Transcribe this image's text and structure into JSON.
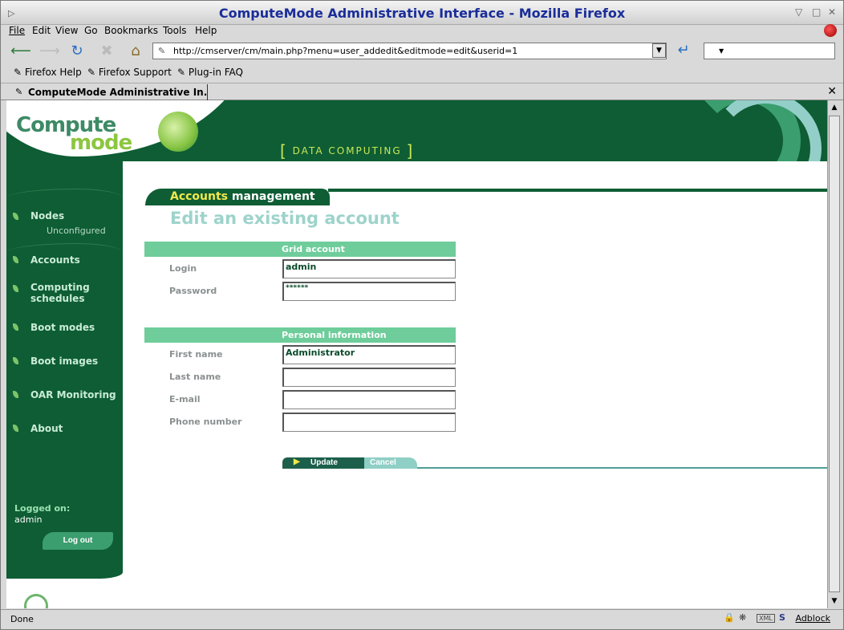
{
  "window": {
    "title": "ComputeMode Administrative Interface - Mozilla Firefox"
  },
  "menu": [
    "File",
    "Edit",
    "View",
    "Go",
    "Bookmarks",
    "Tools",
    "Help"
  ],
  "address": {
    "url": "http://cmserver/cm/main.php?menu=user_addedit&editmode=edit&userid=1"
  },
  "bookmarks": [
    "Firefox Help",
    "Firefox Support",
    "Plug-in FAQ"
  ],
  "tab": {
    "title": "ComputeMode Administrative In..."
  },
  "status": {
    "text": "Done",
    "adblock": "Adblock"
  },
  "brand": {
    "line1": "Compute",
    "line2": "mode",
    "tagline": "DATA  COMPUTING"
  },
  "sidebar": {
    "items": [
      {
        "label": "Nodes"
      },
      {
        "label": "Unconfigured"
      },
      {
        "label": "Accounts"
      },
      {
        "label": "Computing"
      },
      {
        "label": "schedules"
      },
      {
        "label": "Boot modes"
      },
      {
        "label": "Boot images"
      },
      {
        "label": "OAR Monitoring"
      },
      {
        "label": "About"
      }
    ],
    "logged_label": "Logged on:",
    "logged_user": "admin",
    "logout": "Log out"
  },
  "main": {
    "section_highlight": "Accounts",
    "section_rest": " management",
    "title": "Edit an existing account",
    "grid_header": "Grid account",
    "personal_header": "Personal information",
    "fields": {
      "login": {
        "label": "Login",
        "value": "admin"
      },
      "password": {
        "label": "Password",
        "value": "******"
      },
      "first_name": {
        "label": "First name",
        "value": "Administrator"
      },
      "last_name": {
        "label": "Last name",
        "value": ""
      },
      "email": {
        "label": "E-mail",
        "value": ""
      },
      "phone": {
        "label": "Phone number",
        "value": ""
      }
    },
    "update": "Update",
    "cancel": "Cancel"
  },
  "colors": {
    "brand_green": "#0e5d34",
    "accent_green": "#6ecd9a",
    "title_teal": "#9dd3cb",
    "title_blue": "#1a2d9a"
  }
}
